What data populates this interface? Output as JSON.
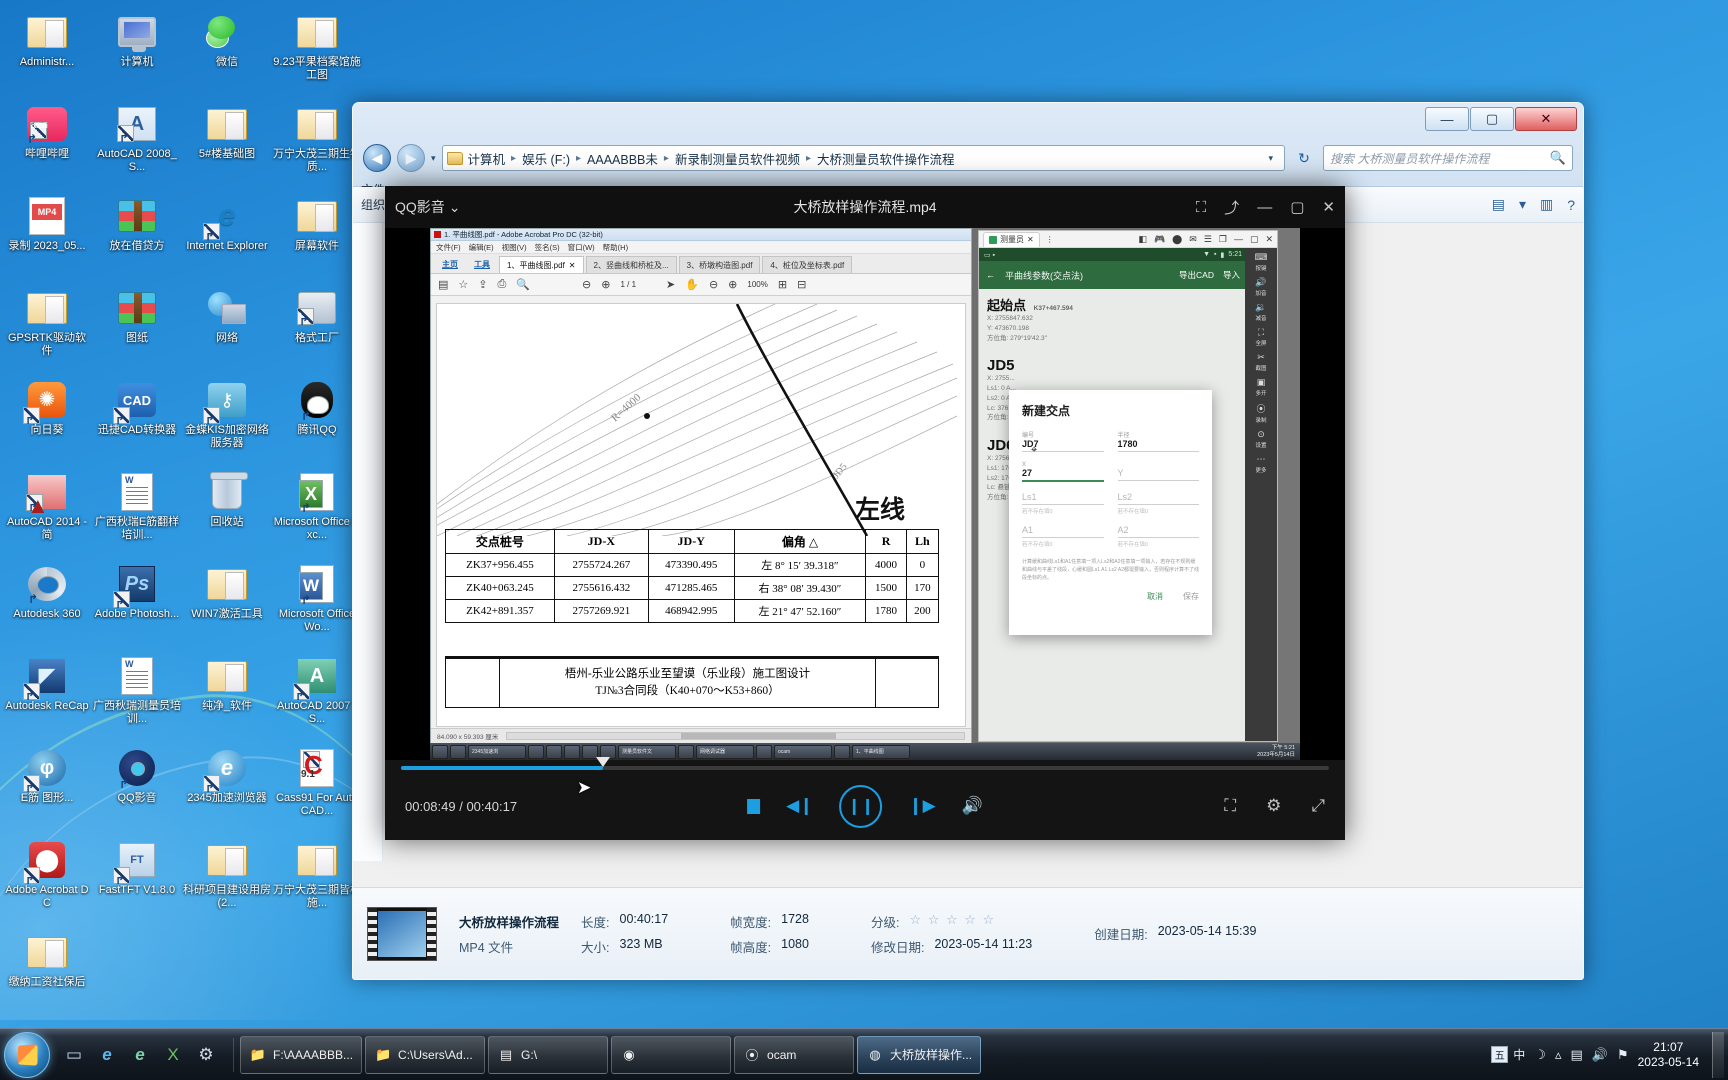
{
  "desktop": {
    "icons": [
      {
        "label": "Administr...",
        "icon": "user-folder-icon",
        "shortcut": false,
        "shape": "ic-folder-open"
      },
      {
        "label": "计算机",
        "icon": "computer-icon",
        "shortcut": false,
        "shape": "ic-monitor"
      },
      {
        "label": "微信",
        "icon": "wechat-icon",
        "shortcut": true,
        "shape": "ic-wechat"
      },
      {
        "label": "9.23平果档案馆施工图",
        "icon": "folder-icon",
        "shortcut": false,
        "shape": "ic-folder-open"
      },
      {
        "label": "哔哩哔哩",
        "icon": "bilibili-icon",
        "shortcut": true,
        "shape": "ic-bili"
      },
      {
        "label": "AutoCAD 2008_S...",
        "icon": "autocad-icon",
        "shortcut": true,
        "shape": "ic-acad"
      },
      {
        "label": "5#楼基础图",
        "icon": "folder-icon",
        "shortcut": false,
        "shape": "ic-folder-open"
      },
      {
        "label": "万宁大茂三期生物质...",
        "icon": "folder-icon",
        "shortcut": false,
        "shape": "ic-folder-open"
      },
      {
        "label": "录制 2023_05...",
        "icon": "mp4-file-icon",
        "shortcut": false,
        "shape": "ic-mp4"
      },
      {
        "label": "放在借贷方",
        "icon": "winrar-icon",
        "shortcut": false,
        "shape": "ic-rar"
      },
      {
        "label": "Internet Explorer",
        "icon": "internet-explorer-icon",
        "shortcut": true,
        "shape": "ic-ie"
      },
      {
        "label": "屏幕软件",
        "icon": "folder-icon",
        "shortcut": false,
        "shape": "ic-folder-open"
      },
      {
        "label": "GPSRTK驱动软件",
        "icon": "folder-icon",
        "shortcut": false,
        "shape": "ic-folder-open"
      },
      {
        "label": "图纸",
        "icon": "winrar-icon",
        "shortcut": false,
        "shape": "ic-rar"
      },
      {
        "label": "网络",
        "icon": "network-icon",
        "shortcut": false,
        "shape": "ic-net"
      },
      {
        "label": "格式工厂",
        "icon": "format-factory-icon",
        "shortcut": true,
        "shape": "ic-formatfactory"
      },
      {
        "label": "向日葵",
        "icon": "sunlogin-icon",
        "shortcut": true,
        "shape": "ic-sunflower"
      },
      {
        "label": "迅捷CAD转换器",
        "icon": "cad-converter-icon",
        "shortcut": true,
        "shape": "ic-cad-conv"
      },
      {
        "label": "金蝶KIS加密网络服务器",
        "icon": "kingdee-kis-icon",
        "shortcut": true,
        "shape": "ic-kis"
      },
      {
        "label": "腾讯QQ",
        "icon": "tencent-qq-icon",
        "shortcut": true,
        "shape": "ic-qq"
      },
      {
        "label": "AutoCAD 2014 - 简",
        "icon": "autocad-2014-icon",
        "shortcut": true,
        "shape": "ic-acad2014"
      },
      {
        "label": "广西秋瑞E筋翻样培训...",
        "icon": "document-icon",
        "shortcut": false,
        "shape": "ic-doc"
      },
      {
        "label": "回收站",
        "icon": "recycle-bin-icon",
        "shortcut": false,
        "shape": "ic-trash"
      },
      {
        "label": "Microsoft Office Exc...",
        "icon": "excel-icon",
        "shortcut": true,
        "shape": "ic-excel"
      },
      {
        "label": "Autodesk 360",
        "icon": "autodesk-360-icon",
        "shortcut": true,
        "shape": "ic-360"
      },
      {
        "label": "Adobe Photosh...",
        "icon": "photoshop-icon",
        "shortcut": true,
        "shape": "ic-ps"
      },
      {
        "label": "WIN7激活工具",
        "icon": "folder-icon",
        "shortcut": false,
        "shape": "ic-folder-open"
      },
      {
        "label": "Microsoft Office Wo...",
        "icon": "word-icon",
        "shortcut": true,
        "shape": "ic-word"
      },
      {
        "label": "Autodesk ReCap",
        "icon": "recap-icon",
        "shortcut": true,
        "shape": "ic-recap"
      },
      {
        "label": "广西秋瑞测量员培训...",
        "icon": "document-icon",
        "shortcut": false,
        "shape": "ic-doc"
      },
      {
        "label": "纯净_软件",
        "icon": "folder-icon",
        "shortcut": false,
        "shape": "ic-folder-open"
      },
      {
        "label": "AutoCAD 2007 - S...",
        "icon": "autocad-2007-icon",
        "shortcut": true,
        "shape": "ic-acad2007"
      },
      {
        "label": "E筋 图形...",
        "icon": "ejin-icon",
        "shortcut": true,
        "shape": "ic-gangjin"
      },
      {
        "label": "QQ影音",
        "icon": "qq-player-icon",
        "shortcut": true,
        "shape": "ic-qqplayer"
      },
      {
        "label": "2345加速浏览器",
        "icon": "2345-browser-icon",
        "shortcut": true,
        "shape": "ic-2345"
      },
      {
        "label": "Cass91 For AutoCAD...",
        "icon": "cass-icon",
        "shortcut": true,
        "shape": "ic-cass"
      },
      {
        "label": "Adobe Acrobat DC",
        "icon": "acrobat-icon",
        "shortcut": true,
        "shape": "ic-pdf"
      },
      {
        "label": "FastTFT V1.8.0",
        "icon": "fasttft-icon",
        "shortcut": true,
        "shape": "ic-fastft"
      },
      {
        "label": "科研项目建设用房(2...",
        "icon": "folder-icon",
        "shortcut": false,
        "shape": "ic-folder-open"
      },
      {
        "label": "万宁大茂三期皆构施...",
        "icon": "folder-icon",
        "shortcut": false,
        "shape": "ic-folder-open"
      },
      {
        "label": "缴纳工资社保后",
        "icon": "folder-icon",
        "shortcut": false,
        "shape": "ic-folder-open"
      }
    ]
  },
  "explorer": {
    "breadcrumbs": [
      "计算机",
      "娱乐 (F:)",
      "AAAABBB未",
      "新录制测量员软件视频",
      "大桥测量员软件操作流程"
    ],
    "search_placeholder": "搜索 大桥测量员软件操作流程",
    "menu": "文件",
    "toolbar": {
      "organize": "组织",
      "star": "☆"
    },
    "nav_back": "◀",
    "nav_forward": "▶",
    "refresh": "↻",
    "network_label": "网络",
    "window_buttons": {
      "minimize": "—",
      "maximize": "▢",
      "close": "✕"
    }
  },
  "details_pane": {
    "file_name": "大桥放样操作流程",
    "file_type": "MP4 文件",
    "fields": [
      {
        "key": "长度:",
        "value": "00:40:17"
      },
      {
        "key": "大小:",
        "value": "323 MB"
      },
      {
        "key": "帧宽度:",
        "value": "1728"
      },
      {
        "key": "帧高度:",
        "value": "1080"
      },
      {
        "key": "分级:",
        "value": "☆ ☆ ☆ ☆ ☆"
      },
      {
        "key": "修改日期:",
        "value": "2023-05-14 11:23"
      },
      {
        "key": "创建日期:",
        "value": "2023-05-14 15:39"
      }
    ]
  },
  "player": {
    "app_name": "QQ影音",
    "app_caret": "⌄",
    "title": "大桥放样操作流程.mp4",
    "titlebar_icons": [
      "screenshot-icon",
      "share-icon"
    ],
    "window_buttons": {
      "minimize": "—",
      "maximize": "▢",
      "close": "✕"
    },
    "time_current": "00:08:49",
    "time_total": "00:40:17",
    "time_display": "00:08:49 / 00:40:17",
    "progress_percent": 21.8,
    "controls": {
      "stop": "stop-icon",
      "previous": "previous-track-icon",
      "play_pause": "pause-icon",
      "next": "next-track-icon",
      "volume": "volume-icon",
      "screenshot": "capture-icon",
      "settings": "equalizer-icon",
      "fullscreen": "fullscreen-icon"
    }
  },
  "video": {
    "acrobat": {
      "window_title": "1. 平曲线图.pdf - Adobe Acrobat Pro DC (32-bit)",
      "menu": [
        "文件(F)",
        "编辑(E)",
        "视图(V)",
        "签名(S)",
        "窗口(W)",
        "帮助(H)"
      ],
      "tabs": [
        "主页",
        "工具",
        "1、平曲线图.pdf",
        "2、竖曲线和桥桩及...",
        "3、桥墩构造图.pdf",
        "4、桩位及坐标表.pdf"
      ],
      "page_indicator": "1 / 1",
      "zoom": "100%",
      "status": "84.090 x 59.393 厘米"
    },
    "drawing": {
      "zuoxian_label": "左线",
      "curve_label": "R=4000",
      "table": {
        "headers": [
          "交点桩号",
          "JD-X",
          "JD-Y",
          "偏角 △",
          "R",
          "Lh"
        ],
        "rows": [
          [
            "ZK37+956.455",
            "2755724.267",
            "473390.495",
            "左 8° 15′ 39.318″",
            "4000",
            "0"
          ],
          [
            "ZK40+063.245",
            "2755616.432",
            "471285.465",
            "右 38° 08′ 39.430″",
            "1500",
            "170"
          ],
          [
            "ZK42+891.357",
            "2757269.921",
            "468942.995",
            "左 21° 47′ 52.160″",
            "1780",
            "200"
          ]
        ]
      },
      "title_block": {
        "line1": "梧州-乐业公路乐业至望谟（乐业段）施工图设计",
        "line2": "TJ№3合同段（K40+070～K53+860）"
      }
    },
    "emulator": {
      "tab_label": "测量员",
      "tab_close": "✕",
      "status_time": "5:21",
      "appbar_title": "平曲线参数(交点法)",
      "appbar_back": "←",
      "appbar_actions": [
        "导出CAD",
        "导入"
      ],
      "start_point": {
        "heading": "起始点",
        "station": "K37+467.594",
        "lines": [
          "X: 2755847.632",
          "Y: 473670.198",
          "方位角: 279°19′42.3″"
        ]
      },
      "points": [
        {
          "name": "JD5",
          "lines": [
            "X: 2755...",
            "Ls1: 0  A...",
            "Ls2: 0  A...",
            "Lc: 376.7...",
            "方位角: 3..."
          ]
        },
        {
          "name": "JD6",
          "lines": [
            "X: 2756...",
            "Ls1: 170...",
            "Ls2: 170...",
            "Lc: 悬链...",
            "方位角: 4..."
          ]
        }
      ],
      "dialog": {
        "title": "新建交点",
        "fields": [
          {
            "label": "编号",
            "value": "JD7",
            "placeholder": "",
            "hint": ""
          },
          {
            "label": "半径",
            "value": "1780",
            "placeholder": "",
            "hint": ""
          },
          {
            "label": "X",
            "value": "27",
            "placeholder": "",
            "hint": "",
            "active": true
          },
          {
            "label": "Y",
            "value": "",
            "placeholder": "Y",
            "hint": ""
          },
          {
            "label": "Ls1",
            "value": "",
            "placeholder": "Ls1",
            "hint": "若不存在填0"
          },
          {
            "label": "Ls2",
            "value": "",
            "placeholder": "Ls2",
            "hint": "若不存在填0"
          },
          {
            "label": "A1",
            "value": "",
            "placeholder": "A1",
            "hint": "若不存在填0"
          },
          {
            "label": "A2",
            "value": "",
            "placeholder": "A2",
            "hint": "若不存在填0"
          }
        ],
        "note": "计算缓和曲线Ls1和A1任意填一项入Ls2和A2任意填一项输入，若存在不规则缓和曲线与平差了线段，心缓和圆Ls1 A1 Ls2 A2都需要输入，否则程序计算不了线段坐标的点。",
        "cancel": "取消",
        "save": "保存"
      },
      "sidebar": [
        {
          "label": "按键",
          "glyph": "⌨"
        },
        {
          "label": "加音",
          "glyph": "🔊"
        },
        {
          "label": "减音",
          "glyph": "🔉"
        },
        {
          "label": "全屏",
          "glyph": "⛶"
        },
        {
          "label": "截图",
          "glyph": "✂"
        },
        {
          "label": "多开",
          "glyph": "▣"
        },
        {
          "label": "录制",
          "glyph": "⦿"
        },
        {
          "label": "设置",
          "glyph": "⊙"
        },
        {
          "label": "更多",
          "glyph": "⋯"
        }
      ],
      "inner_taskbar_clock": "下午 5:21",
      "inner_taskbar_date": "2023年5月14日"
    }
  },
  "taskbar": {
    "start": "start-orb",
    "quick_launch": [
      "show-desktop-icon",
      "internet-explorer-icon",
      "edge-icon",
      "excel-icon",
      "settings-icon"
    ],
    "buttons": [
      {
        "label": "F:\\AAAABBB...",
        "icon": "folder-icon",
        "active": false
      },
      {
        "label": "C:\\Users\\Ad...",
        "icon": "folder-icon",
        "active": false
      },
      {
        "label": "G:\\",
        "icon": "drive-icon",
        "active": false
      },
      {
        "label": "",
        "icon": "chrome-icon",
        "active": false
      },
      {
        "label": "ocam",
        "icon": "ocam-icon",
        "active": false
      },
      {
        "label": "大桥放样操作...",
        "icon": "qq-player-icon",
        "active": true
      }
    ],
    "tray": {
      "ime_lang": "中",
      "ime_box": "五",
      "icons": [
        "moon-icon",
        "network-icon",
        "volume-icon",
        "flag-icon"
      ],
      "time": "21:07",
      "date": "2023-05-14"
    }
  }
}
